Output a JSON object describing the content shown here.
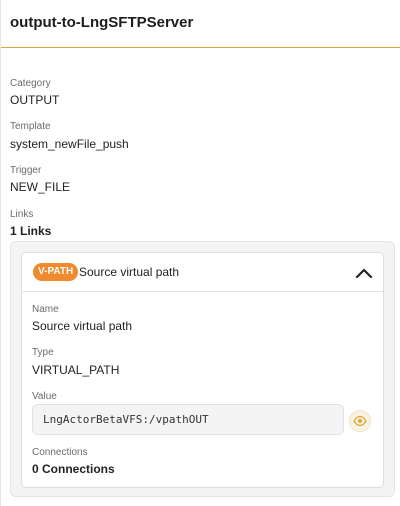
{
  "header": {
    "title": "output-to-LngSFTPServer"
  },
  "fields": {
    "category": {
      "label": "Category",
      "value": "OUTPUT"
    },
    "template": {
      "label": "Template",
      "value": "system_newFile_push"
    },
    "trigger": {
      "label": "Trigger",
      "value": "NEW_FILE"
    },
    "links": {
      "label": "Links",
      "value": "1 Links"
    }
  },
  "link_card": {
    "badge": "V-PATH",
    "title": "Source virtual path",
    "expanded_icon": "chevron-up-icon",
    "name": {
      "label": "Name",
      "value": "Source virtual path"
    },
    "type": {
      "label": "Type",
      "value": "VIRTUAL_PATH"
    },
    "value": {
      "label": "Value",
      "value": "LngActorBetaVFS:/vpathOUT"
    },
    "connections": {
      "label": "Connections",
      "value": "0 Connections"
    },
    "reveal_icon": "eye-icon"
  },
  "colors": {
    "accent": "#ef8a2e",
    "header_rule": "#d9a53a"
  }
}
